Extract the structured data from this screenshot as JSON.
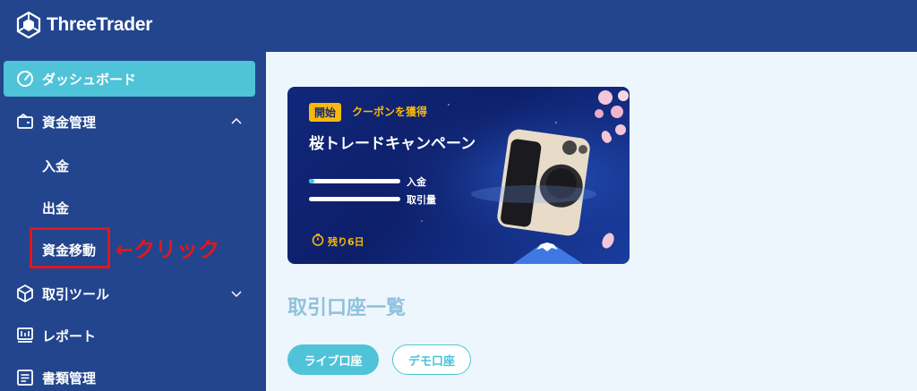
{
  "header": {
    "brand": "ThreeTrader"
  },
  "sidebar": {
    "dashboard": "ダッシュボード",
    "funds": "資金管理",
    "deposit": "入金",
    "withdraw": "出金",
    "transfer": "資金移動",
    "tools": "取引ツール",
    "report": "レポート",
    "documents": "書類管理"
  },
  "annotation": {
    "text": "←クリック",
    "color": "#e4161b"
  },
  "banner": {
    "badge": "開始",
    "coupon": "クーポンを獲得",
    "title": "桜トレードキャンペーン",
    "deposit_label": "入金",
    "volume_label": "取引量",
    "deposit_progress": 0.06,
    "volume_progress": 0,
    "remaining": "残り6日"
  },
  "accounts": {
    "title": "取引口座一覧",
    "live_tab": "ライブ口座",
    "demo_tab": "デモ口座"
  },
  "colors": {
    "primary": "#22458e",
    "accent": "#4fc3d8",
    "highlight": "#e4161b",
    "gold": "#f7b90c"
  },
  "icons": [
    "logo-icon",
    "dashboard-icon",
    "wallet-icon",
    "chevron-up-icon",
    "cube-icon",
    "chevron-down-icon",
    "report-icon",
    "document-icon",
    "clock-icon"
  ]
}
